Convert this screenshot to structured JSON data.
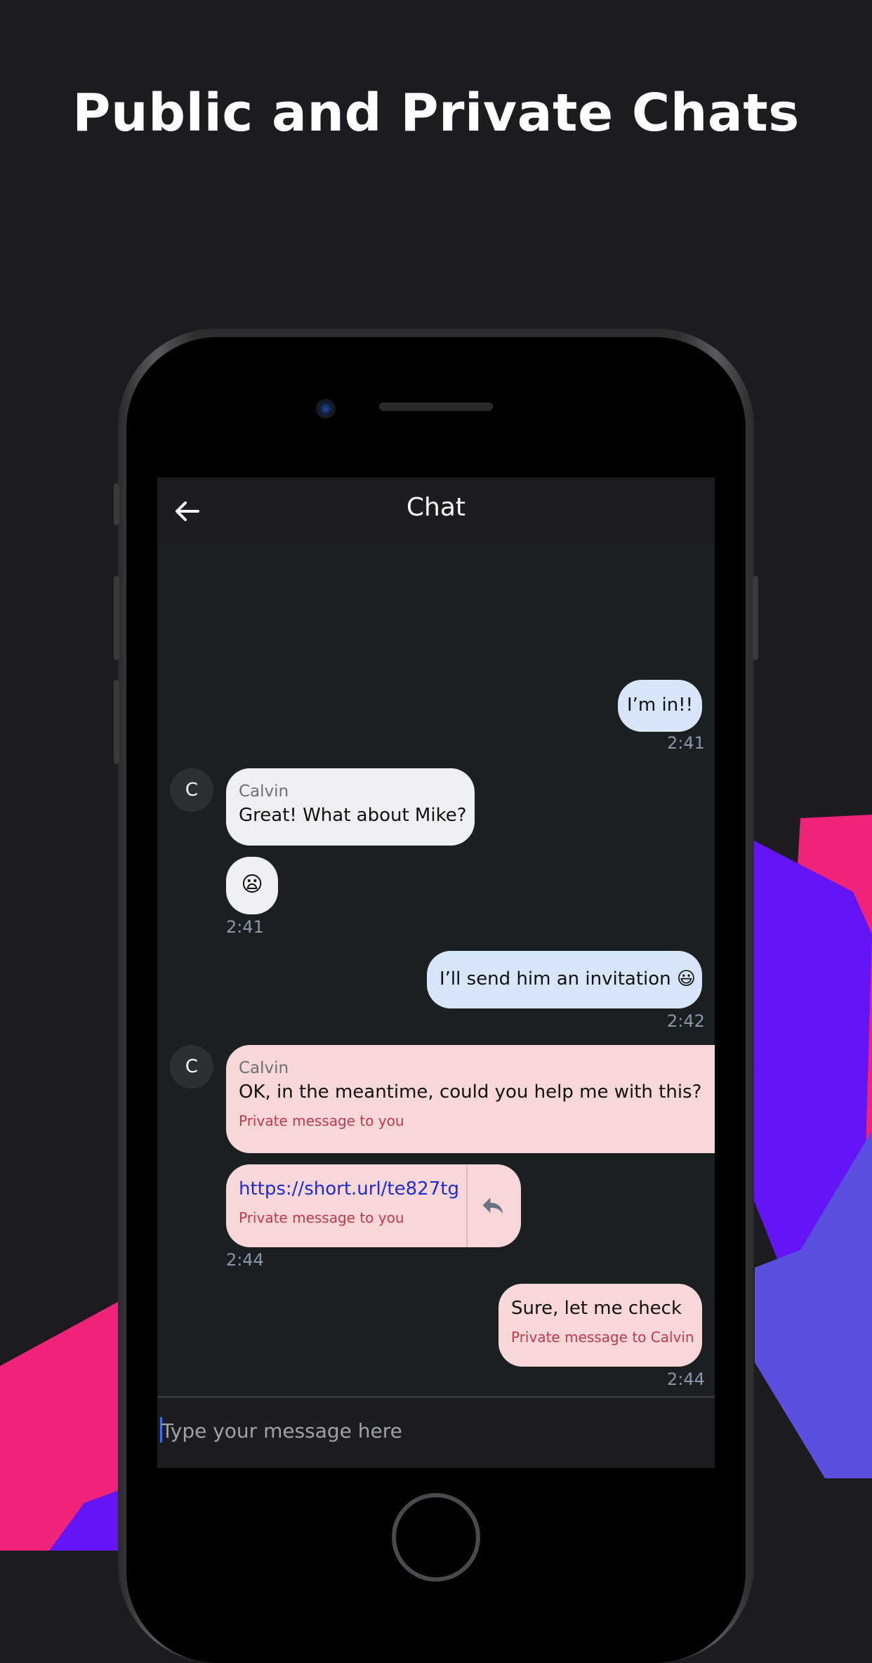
{
  "headline": "Public and Private Chats",
  "appbar": {
    "title": "Chat",
    "back_icon": "arrow-left-icon"
  },
  "messages": [
    {
      "text": "I’m in!!",
      "time": "2:41"
    },
    {
      "sender": "Calvin",
      "avatar": "C",
      "text": "Great! What about Mike?"
    },
    {
      "emoji": "😦",
      "time": "2:41"
    },
    {
      "text": "I’ll send him an invitation 😃",
      "time": "2:42"
    },
    {
      "sender": "Calvin",
      "avatar": "C",
      "text": "OK, in the meantime, could you help me with this?",
      "note": "Private message to you"
    },
    {
      "link": "https://short.url/te827tg",
      "note": "Private message to you",
      "time": "2:44",
      "reply_icon": "reply-icon"
    },
    {
      "text": "Sure, let me check",
      "note": "Private message to Calvin",
      "time": "2:44"
    }
  ],
  "input": {
    "placeholder": "Type your message here"
  },
  "colors": {
    "background": "#1d1b20",
    "screen": "#1c1f22",
    "own_bubble": "#d7e5f8",
    "other_bubble": "#eff0f4",
    "private_bubble": "#f8d7d9",
    "private_note": "#c13a4a",
    "link": "#1f2bd6",
    "shape_pink": "#f0237a",
    "shape_violet": "#6414f5",
    "shape_indigo": "#5a4fde"
  }
}
